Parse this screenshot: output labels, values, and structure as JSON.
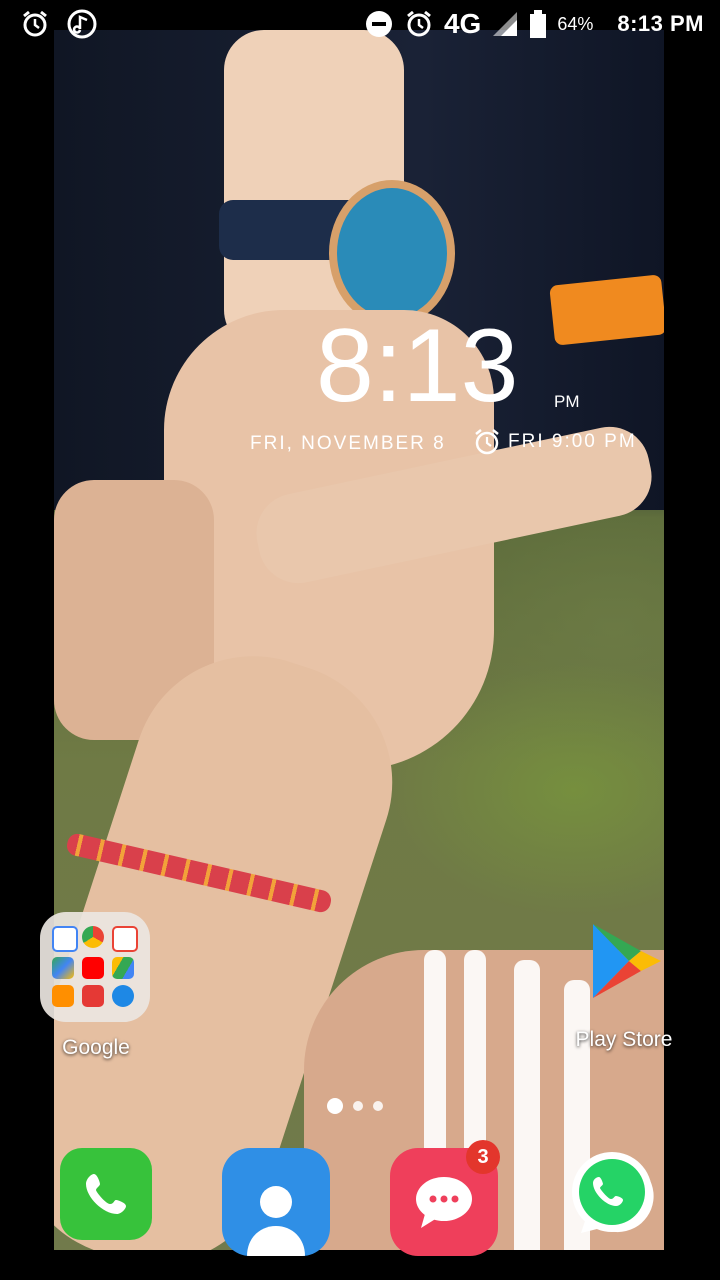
{
  "status_bar": {
    "network": "4G",
    "battery_percent": "64%",
    "time": "8:13 PM",
    "icons": [
      "alarm-icon",
      "music-icon",
      "do-not-disturb-icon",
      "alarm-icon",
      "signal-icon",
      "battery-icon"
    ]
  },
  "clock_widget": {
    "time": "8:13",
    "ampm": "PM",
    "date": "FRI, NOVEMBER 8",
    "next_alarm": "FRI 9:00 PM"
  },
  "home": {
    "folder_label": "Google",
    "play_store_label": "Play Store",
    "pages": 3,
    "current_page": 1
  },
  "dock": {
    "apps": [
      "phone",
      "contacts",
      "messages",
      "whatsapp"
    ],
    "messages_badge": "3"
  },
  "colors": {
    "phone_green": "#37c23b",
    "contacts_blue": "#2f8fe6",
    "messages_red": "#ef3f5b",
    "whatsapp_green": "#25d366",
    "badge_red": "#e3362c"
  }
}
